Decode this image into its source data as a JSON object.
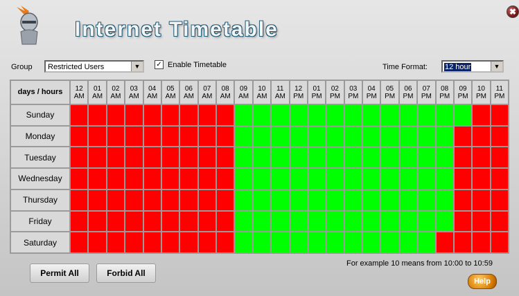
{
  "window": {
    "title": "Internet Timetable",
    "close_glyph": "✖"
  },
  "controls": {
    "group_label": "Group",
    "group_value": "Restricted Users",
    "enable_label": "Enable Timetable",
    "enable_checked": true,
    "time_format_label": "Time Format:",
    "time_format_value": "12 hour"
  },
  "grid": {
    "corner": "days / hours",
    "hours": [
      "12\nAM",
      "01\nAM",
      "02\nAM",
      "03\nAM",
      "04\nAM",
      "05\nAM",
      "06\nAM",
      "07\nAM",
      "08\nAM",
      "09\nAM",
      "10\nAM",
      "11\nAM",
      "12\nPM",
      "01\nPM",
      "02\nPM",
      "03\nPM",
      "04\nPM",
      "05\nPM",
      "06\nPM",
      "07\nPM",
      "08\nPM",
      "09\nPM",
      "10\nPM",
      "11\nPM"
    ],
    "days": [
      "Sunday",
      "Monday",
      "Tuesday",
      "Wednesday",
      "Thursday",
      "Friday",
      "Saturday"
    ],
    "permit_color": "#00ff00",
    "forbid_color": "#ff0000",
    "schedule": [
      [
        0,
        0,
        0,
        0,
        0,
        0,
        0,
        0,
        0,
        1,
        1,
        1,
        1,
        1,
        1,
        1,
        1,
        1,
        1,
        1,
        1,
        1,
        0,
        0
      ],
      [
        0,
        0,
        0,
        0,
        0,
        0,
        0,
        0,
        0,
        1,
        1,
        1,
        1,
        1,
        1,
        1,
        1,
        1,
        1,
        1,
        1,
        0,
        0,
        0
      ],
      [
        0,
        0,
        0,
        0,
        0,
        0,
        0,
        0,
        0,
        1,
        1,
        1,
        1,
        1,
        1,
        1,
        1,
        1,
        1,
        1,
        1,
        0,
        0,
        0
      ],
      [
        0,
        0,
        0,
        0,
        0,
        0,
        0,
        0,
        0,
        1,
        1,
        1,
        1,
        1,
        1,
        1,
        1,
        1,
        1,
        1,
        1,
        0,
        0,
        0
      ],
      [
        0,
        0,
        0,
        0,
        0,
        0,
        0,
        0,
        0,
        1,
        1,
        1,
        1,
        1,
        1,
        1,
        1,
        1,
        1,
        1,
        1,
        0,
        0,
        0
      ],
      [
        0,
        0,
        0,
        0,
        0,
        0,
        0,
        0,
        0,
        1,
        1,
        1,
        1,
        1,
        1,
        1,
        1,
        1,
        1,
        1,
        1,
        0,
        0,
        0
      ],
      [
        0,
        0,
        0,
        0,
        0,
        0,
        0,
        0,
        0,
        1,
        1,
        1,
        1,
        1,
        1,
        1,
        1,
        1,
        1,
        1,
        0,
        0,
        0,
        0
      ]
    ]
  },
  "footer": {
    "permit_all": "Permit All",
    "forbid_all": "Forbid All",
    "example_note": "For example 10 means from 10:00 to 10:59",
    "help": "Help"
  }
}
